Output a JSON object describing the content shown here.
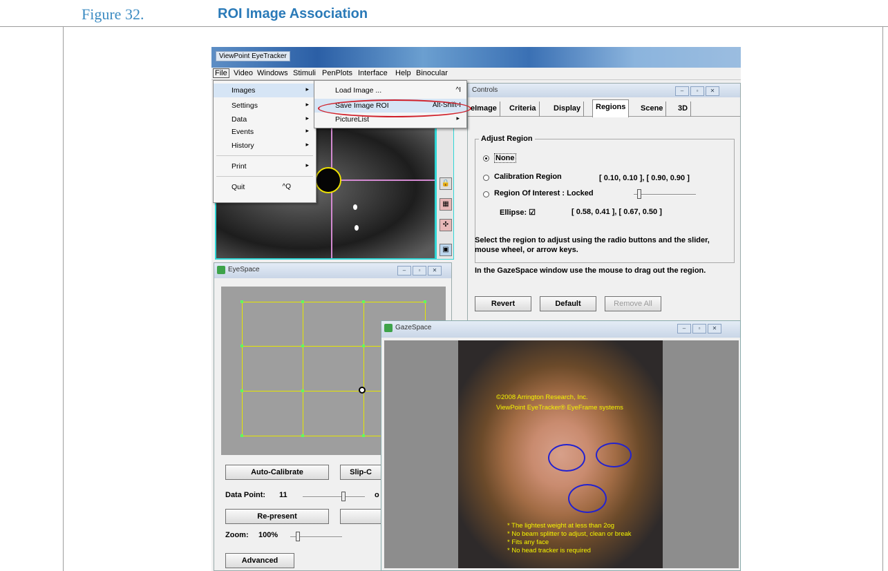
{
  "caption": {
    "number": "Figure 32.",
    "title": "ROI Image Association"
  },
  "app": {
    "title": "ViewPoint EyeTracker"
  },
  "menubar": [
    "File",
    "Video",
    "Windows",
    "Stimuli",
    "PenPlots",
    "Interface",
    "Help",
    "Binocular"
  ],
  "file_menu": [
    {
      "label": "Images",
      "arrow": "▸"
    },
    {
      "label": "Settings",
      "arrow": "▸"
    },
    {
      "label": "Data",
      "arrow": "▸"
    },
    {
      "label": "Events",
      "arrow": "▸"
    },
    {
      "label": "History",
      "arrow": "▸"
    },
    {
      "label": "Print",
      "arrow": "▸"
    },
    {
      "label": "Quit",
      "shortcut": "^Q"
    }
  ],
  "images_menu": [
    {
      "label": "Load Image ...",
      "shortcut": "^I"
    },
    {
      "label": "Save Image ROI",
      "shortcut": "Alt-Shift-I"
    },
    {
      "label": "PictureList",
      "arrow": "▸"
    }
  ],
  "eyespace": {
    "title": "EyeSpace",
    "auto_calibrate": "Auto-Calibrate",
    "slip_label": "Slip-C",
    "data_point_label": "Data Point:",
    "data_point_value": "11",
    "data_point_tail": "o",
    "re_present": "Re-present",
    "zoom_label": "Zoom:",
    "zoom_value": "100%",
    "advanced": "Advanced"
  },
  "controls": {
    "title": "Controls",
    "tabs": [
      "eImage",
      "Criteria",
      "Display",
      "Regions",
      "Scene",
      "3D"
    ],
    "active_tab": "Regions",
    "group_title": "Adjust Region",
    "radio_none": "None",
    "radio_calibration": "Calibration Region",
    "calibration_coords": "[ 0.10, 0.10 ], [ 0.90, 0.90 ]",
    "radio_roi": "Region Of Interest  :  Locked",
    "ellipse_label": "Ellipse: ☑",
    "ellipse_coords": "[ 0.58, 0.41 ], [ 0.67, 0.50 ]",
    "help1": "Select the region to adjust using the radio buttons and the slider, mouse wheel, or arrow keys.",
    "help2": "In the GazeSpace window use the mouse to drag out the region.",
    "revert": "Revert",
    "default": "Default",
    "remove_all": "Remove All"
  },
  "gazespace": {
    "title": "GazeSpace",
    "copyright": "©2008 Arrington Research, Inc.",
    "product": "ViewPoint EyeTracker® EyeFrame systems",
    "bullets": [
      "* The lightest weight at less than 2og",
      "* No beam splitter to adjust, clean or break",
      "* Fits any face",
      "* No head tracker is required"
    ]
  },
  "window_controls": {
    "minimize": "–",
    "restore": "▫",
    "close": "✕"
  },
  "colors": {
    "caption_blue": "#2a7ab8",
    "roi_ellipse": "#2222d0",
    "highlight_red": "#d0202a",
    "grid_yellow": "#e6e600"
  }
}
